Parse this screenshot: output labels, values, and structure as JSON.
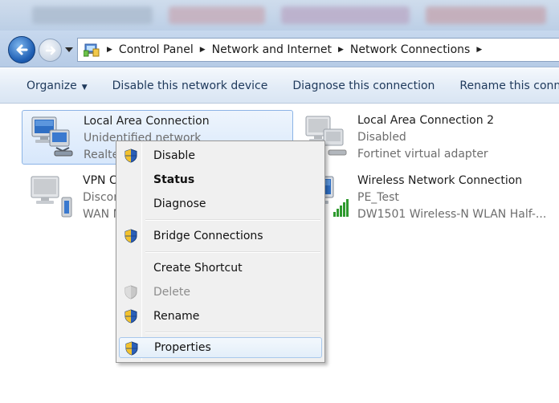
{
  "breadcrumbs": [
    "Control Panel",
    "Network and Internet",
    "Network Connections"
  ],
  "commandbar": {
    "organize": "Organize",
    "disable_device": "Disable this network device",
    "diagnose": "Diagnose this connection",
    "rename": "Rename this connection"
  },
  "connections": [
    {
      "name": "Local Area Connection",
      "status": "Unidentified network",
      "device": "Realtek PCIe GBE Family Controller"
    },
    {
      "name": "Local Area Connection 2",
      "status": "Disabled",
      "device": "Fortinet virtual adapter"
    },
    {
      "name": "VPN Connection",
      "status": "Disconnected",
      "device": "WAN Miniport (IKEv2)"
    },
    {
      "name": "Wireless Network Connection",
      "status": "PE_Test",
      "device": "DW1501 Wireless-N WLAN Half-..."
    }
  ],
  "context_menu": {
    "disable": "Disable",
    "status": "Status",
    "diagnose": "Diagnose",
    "bridge": "Bridge Connections",
    "shortcut": "Create Shortcut",
    "delete": "Delete",
    "rename": "Rename",
    "properties": "Properties"
  },
  "icons": {
    "back": "back-arrow-icon",
    "forward": "forward-arrow-icon",
    "shield": "uac-shield-icon",
    "network": "network-computer-icon",
    "signal": "wireless-signal-icon"
  }
}
